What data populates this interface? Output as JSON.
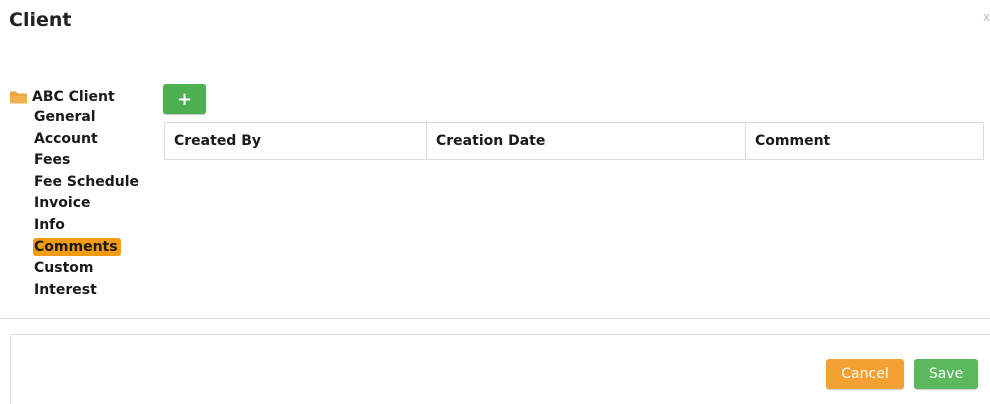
{
  "dialog": {
    "title": "Client",
    "close_glyph": "x"
  },
  "tree": {
    "root_label": "ABC Client",
    "root_icon": "folder-icon",
    "items": [
      {
        "label": "General",
        "selected": false
      },
      {
        "label": "Account",
        "selected": false
      },
      {
        "label": "Fees",
        "selected": false
      },
      {
        "label": "Fee Schedule",
        "selected": false
      },
      {
        "label": "Invoice",
        "selected": false
      },
      {
        "label": "Info",
        "selected": false
      },
      {
        "label": "Comments",
        "selected": true
      },
      {
        "label": "Custom",
        "selected": false
      },
      {
        "label": "Interest",
        "selected": false
      }
    ]
  },
  "toolbar": {
    "add_icon": "plus-icon",
    "add_glyph": "+"
  },
  "grid": {
    "columns": [
      "Created By",
      "Creation Date",
      "Comment"
    ],
    "rows": []
  },
  "footer": {
    "cancel_label": "Cancel",
    "save_label": "Save"
  },
  "colors": {
    "selected_highlight": "#f39c12",
    "add_button": "#4caf50",
    "cancel_button": "#f5a033",
    "save_button": "#5cb85c"
  }
}
